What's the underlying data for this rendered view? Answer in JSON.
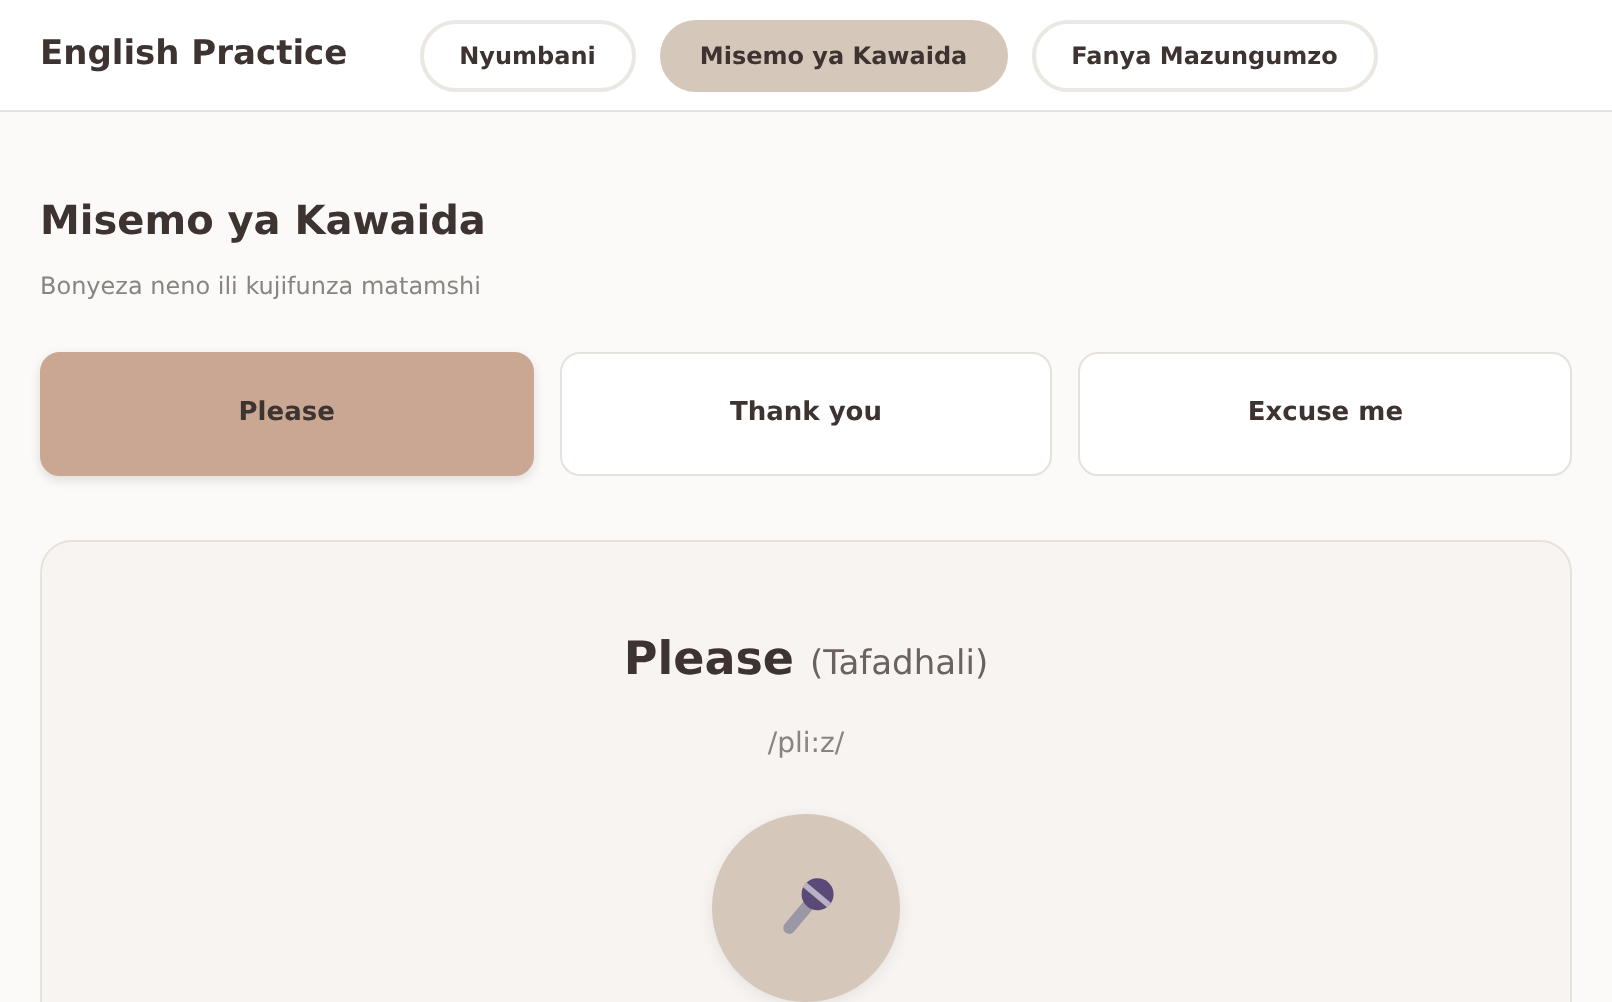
{
  "app_title": "English Practice",
  "nav": [
    {
      "label": "Nyumbani",
      "selected": false
    },
    {
      "label": "Misemo ya Kawaida",
      "selected": true
    },
    {
      "label": "Fanya Mazungumzo",
      "selected": false
    }
  ],
  "page_title": "Misemo ya Kawaida",
  "instruction": "Bonyeza neno ili kujifunza matamshi",
  "phrases": [
    {
      "label": "Please",
      "selected": true
    },
    {
      "label": "Thank you",
      "selected": false
    },
    {
      "label": "Excuse me",
      "selected": false
    }
  ],
  "detail": {
    "word": "Please",
    "translation": "(Tafadhali)",
    "pronunciation": "/pli:z/"
  }
}
